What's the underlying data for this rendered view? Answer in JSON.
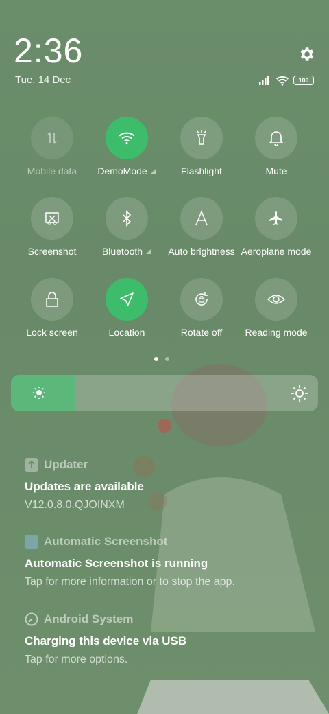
{
  "status": {
    "time": "2:36",
    "date": "Tue, 14 Dec",
    "battery": "100",
    "icons": [
      "signal-icon",
      "wifi-icon",
      "battery-icon"
    ]
  },
  "tiles": [
    {
      "label": "Mobile data",
      "icon": "mobile-data-icon",
      "state": "disabled"
    },
    {
      "label": "DemoMode",
      "icon": "wifi-icon",
      "state": "on",
      "expandable": true
    },
    {
      "label": "Flashlight",
      "icon": "flashlight-icon",
      "state": "off"
    },
    {
      "label": "Mute",
      "icon": "bell-icon",
      "state": "off"
    },
    {
      "label": "Screenshot",
      "icon": "screenshot-icon",
      "state": "off"
    },
    {
      "label": "Bluetooth",
      "icon": "bluetooth-icon",
      "state": "off",
      "expandable": true
    },
    {
      "label": "Auto brightness",
      "icon": "auto-brightness-icon",
      "state": "off"
    },
    {
      "label": "Aeroplane mode",
      "icon": "airplane-icon",
      "state": "off"
    },
    {
      "label": "Lock screen",
      "icon": "lock-icon",
      "state": "off"
    },
    {
      "label": "Location",
      "icon": "location-icon",
      "state": "on"
    },
    {
      "label": "Rotate off",
      "icon": "rotate-lock-icon",
      "state": "off"
    },
    {
      "label": "Reading mode",
      "icon": "eye-icon",
      "state": "off"
    }
  ],
  "pager": {
    "pages": 2,
    "current": 1
  },
  "brightness": {
    "level": 0.21
  },
  "colors": {
    "accent": "#3dbd6b",
    "brightness_fill": "#5cb77a"
  },
  "notifications": [
    {
      "app": "Updater",
      "title": "Updates are available",
      "text": "V12.0.8.0.QJOINXM"
    },
    {
      "app": "Automatic Screenshot",
      "title": "Automatic Screenshot is running",
      "text": "Tap for more information or to stop the app."
    },
    {
      "app": "Android System",
      "title": "Charging this device via USB",
      "text": "Tap for more options."
    }
  ]
}
